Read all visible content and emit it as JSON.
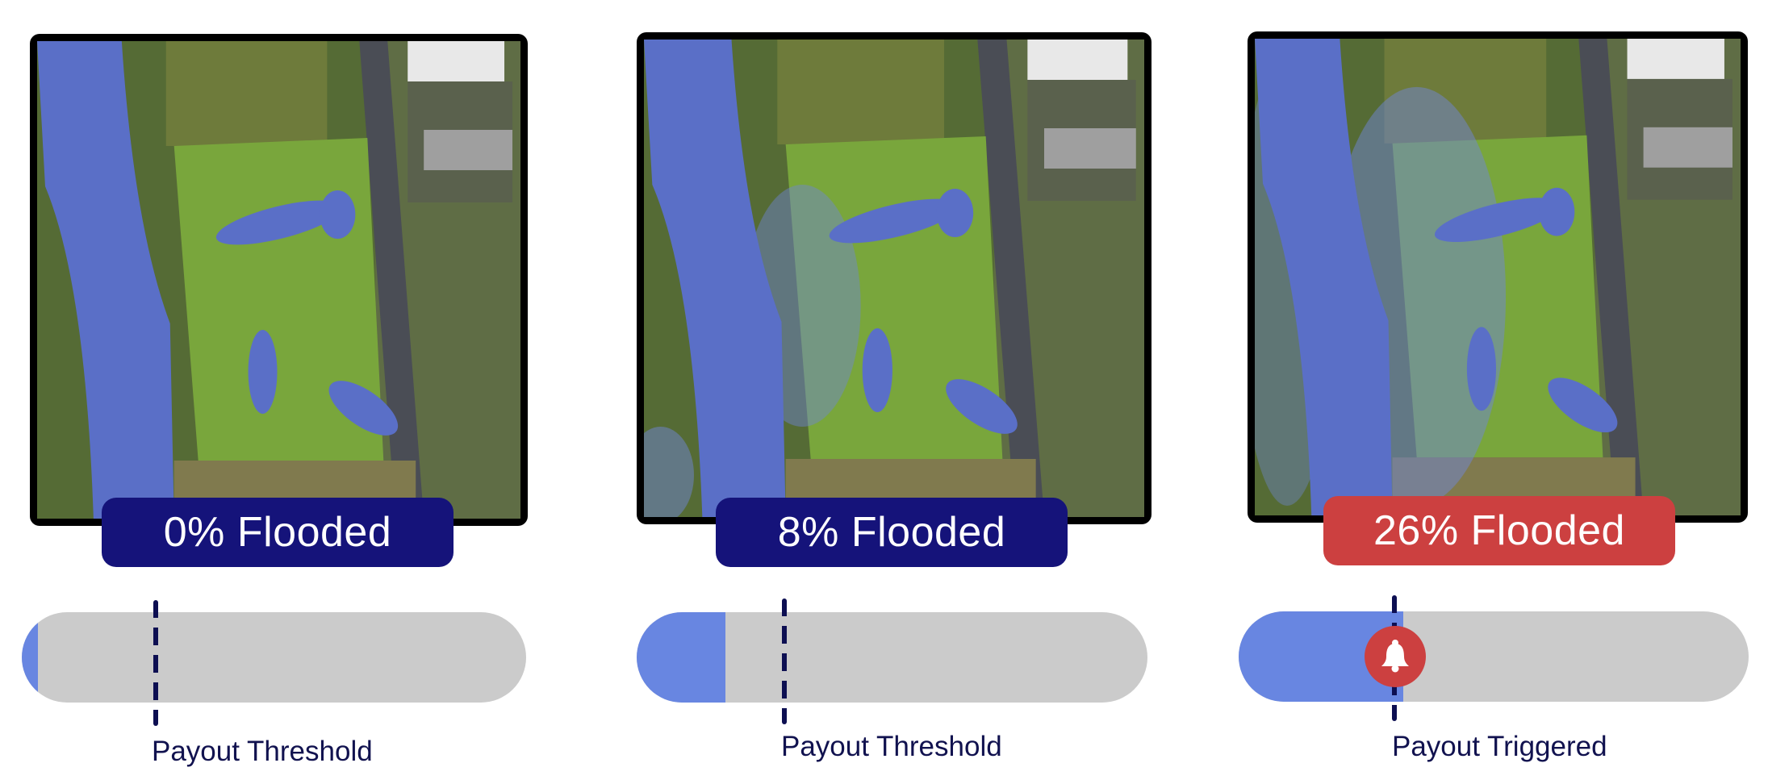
{
  "colors": {
    "normal_badge": "#15137a",
    "alert_badge": "#cc4040",
    "water": "#5a6fc7",
    "bar_fill": "#6886e1",
    "bar_track": "#cbcbcb",
    "threshold_line": "#0d0f52",
    "caption_text": "#11124f"
  },
  "payout_threshold_fraction": 0.26,
  "panels": [
    {
      "badge_label": "0% Flooded",
      "flooded_percent": 0,
      "bar_fill_fraction": 0.03,
      "state": "normal",
      "caption": "Payout Threshold",
      "map_description": "aerial view of golf course beside river, no flooding"
    },
    {
      "badge_label": "8% Flooded",
      "flooded_percent": 8,
      "bar_fill_fraction": 0.17,
      "state": "normal",
      "caption": "Payout Threshold",
      "map_description": "aerial view of golf course with light flooding near riverbank"
    },
    {
      "badge_label": "26% Flooded",
      "flooded_percent": 26,
      "bar_fill_fraction": 0.32,
      "state": "alert",
      "caption": "Payout Triggered",
      "icon": "bell-icon",
      "map_description": "aerial view of golf course with flooding spread across western holes"
    }
  ]
}
